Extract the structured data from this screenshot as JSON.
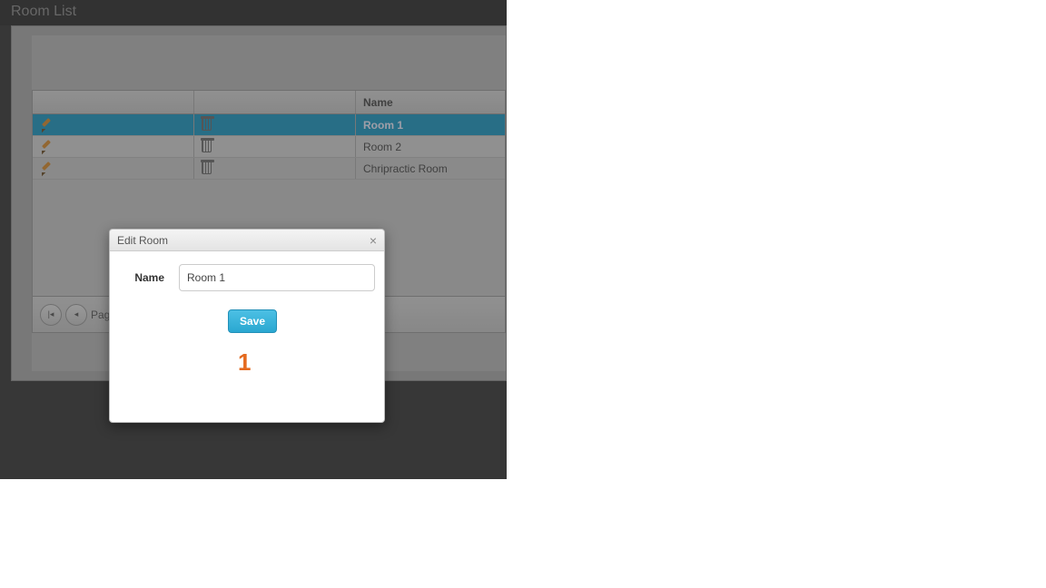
{
  "header": {
    "title": "Room List"
  },
  "grid": {
    "columns": {
      "edit": "",
      "delete": "",
      "name": "Name"
    },
    "rows": [
      {
        "name": "Room 1",
        "selected": true
      },
      {
        "name": "Room 2",
        "selected": false
      },
      {
        "name": "Chripractic Room",
        "selected": false
      }
    ]
  },
  "paginator": {
    "label_prefix": "Pag"
  },
  "dialog": {
    "title": "Edit Room",
    "close": "×",
    "name_label": "Name",
    "name_value": "Room 1",
    "save_label": "Save"
  },
  "annotation": {
    "number": "1"
  }
}
